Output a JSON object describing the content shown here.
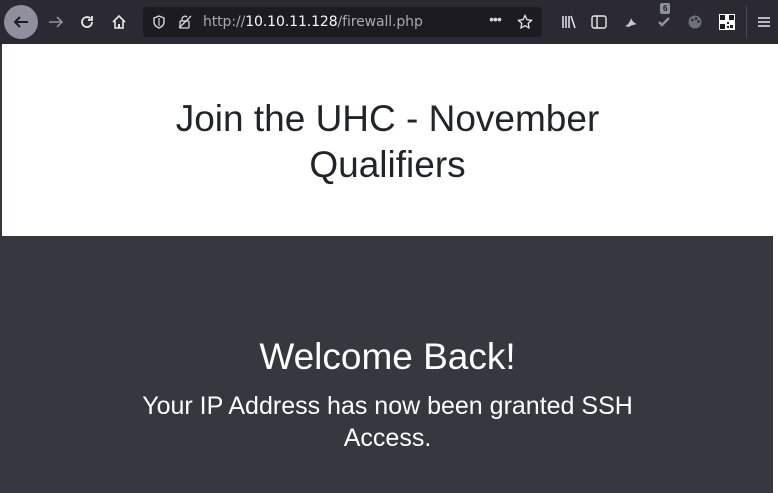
{
  "browser": {
    "url_scheme": "http://",
    "url_host": "10.10.11.128",
    "url_path": "/firewall.php",
    "extension_badge": "6",
    "page_actions": "•••"
  },
  "page": {
    "hero_title_line1": "Join the UHC - November",
    "hero_title_line2": "Qualifiers",
    "welcome_heading": "Welcome Back!",
    "message_line1": "Your IP Address has now been granted SSH",
    "message_line2": "Access."
  },
  "colors": {
    "toolbar": "#2b2a33",
    "urlbar": "#1c1b22",
    "hero_bg": "#ffffff",
    "main_bg": "#35383f"
  }
}
